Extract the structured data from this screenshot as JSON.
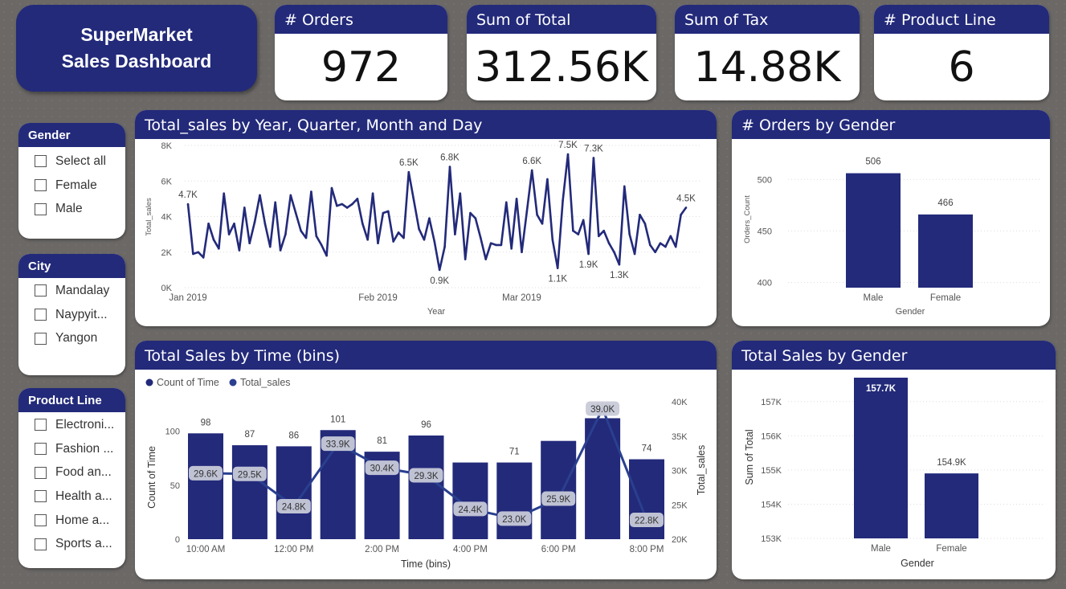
{
  "dashboard_title": "SuperMarket Sales Dashboard",
  "kpis": [
    {
      "label": "# Orders",
      "value": "972"
    },
    {
      "label": "Sum of Total",
      "value": "312.56K"
    },
    {
      "label": "Sum of Tax",
      "value": "14.88K"
    },
    {
      "label": "# Product Line",
      "value": "6"
    }
  ],
  "slicers": {
    "gender": {
      "title": "Gender",
      "items": [
        "Select all",
        "Female",
        "Male"
      ]
    },
    "city": {
      "title": "City",
      "items": [
        "Mandalay",
        "Naypyit...",
        "Yangon"
      ]
    },
    "product_line": {
      "title": "Product Line",
      "items": [
        "Electroni...",
        "Fashion ...",
        "Food an...",
        "Health a...",
        "Home a...",
        "Sports a..."
      ]
    }
  },
  "colors": {
    "navy": "#232a7a",
    "line": "#2a3f8f",
    "label_bg": "#c8cad8"
  },
  "chart_data": [
    {
      "type": "line",
      "title": "Total_sales by Year, Quarter, Month and Day",
      "xlabel": "Year",
      "ylabel": "Total_sales",
      "ylim": [
        0,
        8000
      ],
      "yticks": [
        "0K",
        "2K",
        "4K",
        "6K",
        "8K"
      ],
      "xticks": [
        "Jan 2019",
        "Feb 2019",
        "Mar 2019"
      ],
      "values": [
        4700,
        1900,
        2000,
        1700,
        3600,
        2700,
        2200,
        5300,
        3000,
        3600,
        2100,
        4500,
        2500,
        3700,
        5200,
        3600,
        2300,
        4800,
        2100,
        3000,
        5200,
        4200,
        3200,
        2800,
        5400,
        2900,
        2400,
        1800,
        5600,
        4600,
        4700,
        4500,
        4700,
        5000,
        3600,
        2700,
        5300,
        2500,
        4200,
        4300,
        2600,
        3100,
        2800,
        6500,
        4900,
        3300,
        2700,
        3900,
        2600,
        1000,
        2300,
        6800,
        3000,
        5300,
        1600,
        4200,
        3900,
        2800,
        1600,
        2500,
        2400,
        2400,
        4800,
        2200,
        5000,
        2000,
        4300,
        6600,
        4100,
        3600,
        6100,
        2700,
        1100,
        4900,
        7500,
        3200,
        3000,
        3800,
        1900,
        7300,
        2900,
        3200,
        2500,
        2000,
        1300,
        5700,
        3000,
        1900,
        4100,
        3600,
        2400,
        2000,
        2500,
        2300,
        2900,
        2300,
        4100,
        4500
      ],
      "data_labels": [
        {
          "index": 0,
          "text": "4.7K"
        },
        {
          "index": 43,
          "text": "6.5K"
        },
        {
          "index": 49,
          "text": "0.9K"
        },
        {
          "index": 51,
          "text": "6.8K"
        },
        {
          "index": 67,
          "text": "6.6K"
        },
        {
          "index": 72,
          "text": "1.1K"
        },
        {
          "index": 74,
          "text": "7.5K"
        },
        {
          "index": 78,
          "text": "1.9K"
        },
        {
          "index": 79,
          "text": "7.3K"
        },
        {
          "index": 84,
          "text": "1.3K"
        },
        {
          "index": 97,
          "text": "4.5K"
        }
      ]
    },
    {
      "type": "bar",
      "title": "# Orders by Gender",
      "xlabel": "Gender",
      "ylabel": "Orders_Count",
      "categories": [
        "Male",
        "Female"
      ],
      "values": [
        506,
        466
      ],
      "labels": [
        "506",
        "466"
      ],
      "ylim": [
        395,
        508
      ],
      "yticks": [
        "400",
        "450",
        "500"
      ]
    },
    {
      "type": "bar",
      "title": "Total Sales by Time (bins)",
      "xlabel": "Time (bins)",
      "ylabel": "Count of Time",
      "y2label": "Total_sales",
      "legend": [
        "Count of Time",
        "Total_sales"
      ],
      "categories": [
        "10:00 AM",
        "",
        "12:00 PM",
        "",
        "2:00 PM",
        "",
        "4:00 PM",
        "",
        "6:00 PM",
        "",
        "8:00 PM"
      ],
      "series": [
        {
          "name": "Count of Time",
          "values": [
            98,
            87,
            86,
            101,
            81,
            96,
            71,
            71,
            91,
            112,
            74
          ],
          "labels": [
            "98",
            "87",
            "86",
            "101",
            "81",
            "96",
            "",
            "71",
            "",
            "112",
            "74"
          ]
        },
        {
          "name": "Total_sales",
          "values": [
            29.6,
            29.5,
            24.8,
            33.9,
            30.4,
            29.3,
            24.4,
            23.0,
            25.9,
            39.0,
            22.8
          ],
          "labels": [
            "29.6K",
            "29.5K",
            "24.8K",
            "33.9K",
            "30.4K",
            "29.3K",
            "24.4K",
            "23.0K",
            "25.9K",
            "39.0K",
            "22.8K"
          ]
        }
      ],
      "ylim": [
        0,
        125
      ],
      "yticks": [
        "0",
        "50",
        "100"
      ],
      "y2lim": [
        20,
        40
      ],
      "y2ticks": [
        "20K",
        "25K",
        "30K",
        "35K",
        "40K"
      ]
    },
    {
      "type": "bar",
      "title": "Total Sales by Gender",
      "xlabel": "Gender",
      "ylabel": "Sum of Total",
      "categories": [
        "Male",
        "Female"
      ],
      "values": [
        157.7,
        154.9
      ],
      "labels": [
        "157.7K",
        "154.9K"
      ],
      "ylim": [
        153,
        157.7
      ],
      "yticks": [
        "153K",
        "154K",
        "155K",
        "156K",
        "157K"
      ]
    }
  ]
}
